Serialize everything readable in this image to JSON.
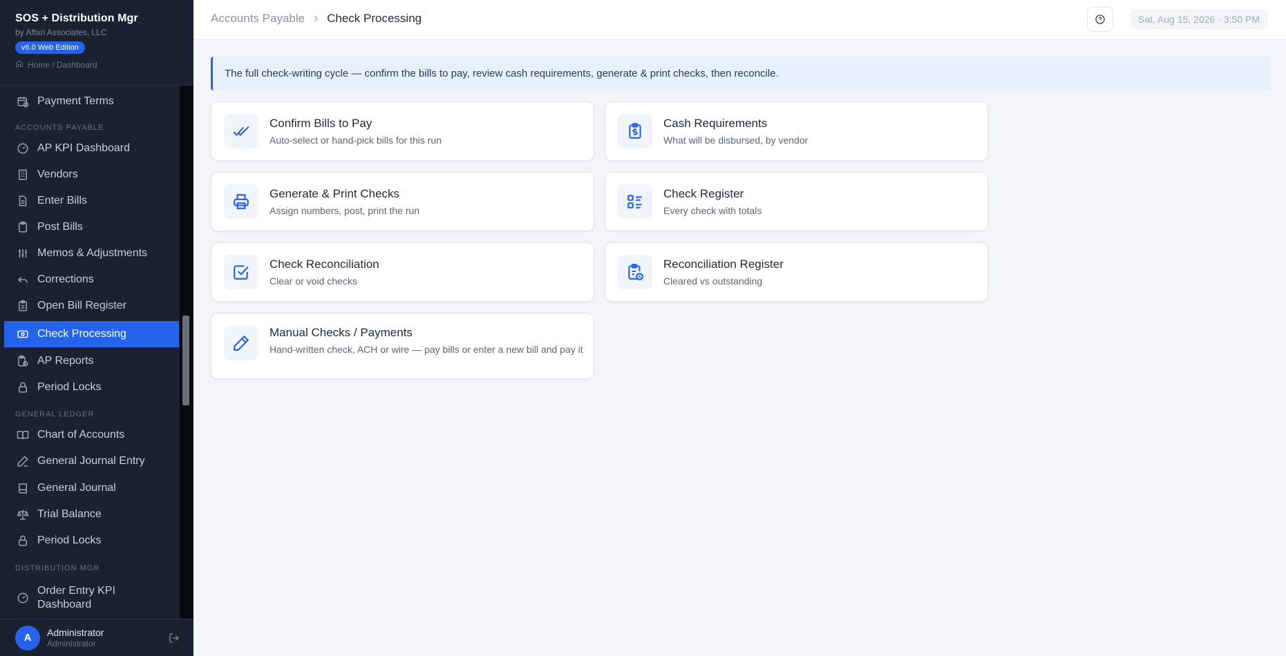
{
  "app": {
    "title": "SOS + Distribution Mgr",
    "subtitle": "by Affari Associates, LLC",
    "version": "v6.0 Web Edition",
    "home_crumb": "Home / Dashboard"
  },
  "sidebar": {
    "items": [
      {
        "label": "Payment Terms",
        "icon": "calendar-clock-icon"
      },
      {
        "label": "AP KPI Dashboard",
        "icon": "gauge-icon"
      },
      {
        "label": "Vendors",
        "icon": "building-icon"
      },
      {
        "label": "Enter Bills",
        "icon": "file-text-icon"
      },
      {
        "label": "Post Bills",
        "icon": "clipboard-icon"
      },
      {
        "label": "Memos & Adjustments",
        "icon": "sliders-icon"
      },
      {
        "label": "Corrections",
        "icon": "undo-icon"
      },
      {
        "label": "Open Bill Register",
        "icon": "clipboard-list-icon"
      },
      {
        "label": "Check Processing",
        "icon": "banknote-icon"
      },
      {
        "label": "AP Reports",
        "icon": "report-clock-icon"
      },
      {
        "label": "Period Locks",
        "icon": "lock-icon"
      },
      {
        "label": "Chart of Accounts",
        "icon": "book-open-icon"
      },
      {
        "label": "General Journal Entry",
        "icon": "pen-line-icon"
      },
      {
        "label": "General Journal",
        "icon": "book-icon"
      },
      {
        "label": "Trial Balance",
        "icon": "scale-icon"
      },
      {
        "label": "Period Locks",
        "icon": "lock-icon"
      },
      {
        "label": "Order Entry KPI Dashboard",
        "icon": "gauge-icon"
      }
    ],
    "sections": {
      "accounts_payable": "ACCOUNTS PAYABLE",
      "general_ledger": "GENERAL LEDGER",
      "distribution_mgr": "DISTRIBUTION MGR"
    },
    "active_item": "Check Processing"
  },
  "user": {
    "initial": "A",
    "name": "Administrator",
    "role": "Administrator"
  },
  "header": {
    "breadcrumb_parent": "Accounts Payable",
    "breadcrumb_current": "Check Processing",
    "datetime": "Sat, Aug 15, 2026 · 3:50 PM"
  },
  "main": {
    "banner": "The full check-writing cycle — confirm the bills to pay, review cash requirements, generate & print checks, then reconcile.",
    "cards": [
      {
        "title": "Confirm Bills to Pay",
        "desc": "Auto-select or hand-pick bills for this run",
        "icon": "double-check-icon"
      },
      {
        "title": "Cash Requirements",
        "desc": "What will be disbursed, by vendor",
        "icon": "clipboard-dollar-icon"
      },
      {
        "title": "Generate & Print Checks",
        "desc": "Assign numbers, post, print the run",
        "icon": "printer-icon"
      },
      {
        "title": "Check Register",
        "desc": "Every check with totals",
        "icon": "list-checks-icon"
      },
      {
        "title": "Check Reconciliation",
        "desc": "Clear or void checks",
        "icon": "checkbox-icon"
      },
      {
        "title": "Reconciliation Register",
        "desc": "Cleared vs outstanding",
        "icon": "clipboard-clock-icon"
      },
      {
        "title": "Manual Checks / Payments",
        "desc": "Hand-written check, ACH or wire — pay bills or enter a new bill and pay it",
        "icon": "pencil-icon"
      }
    ]
  },
  "colors": {
    "sidebar_bg": "#1b2130",
    "accent": "#2563eb",
    "page_bg": "#f3f5f8",
    "banner_bg": "#e8f0fb"
  }
}
